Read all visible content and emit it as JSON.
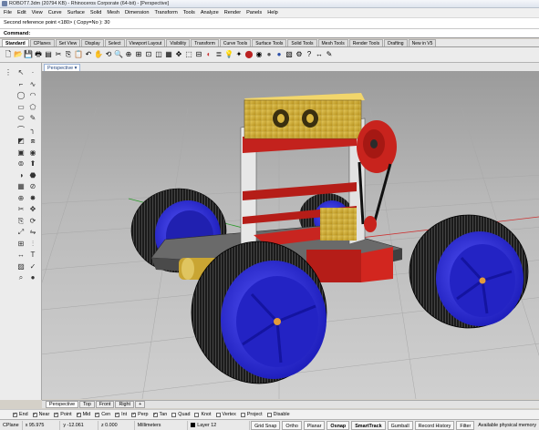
{
  "window": {
    "title": "ROBOT7.3dm (20794 KB) - Rhinoceros Corporate (64-bit) - [Perspective]"
  },
  "menu": [
    "File",
    "Edit",
    "View",
    "Curve",
    "Surface",
    "Solid",
    "Mesh",
    "Dimension",
    "Transform",
    "Tools",
    "Analyze",
    "Render",
    "Panels",
    "Help"
  ],
  "command_history": "Second reference point <180> ( Copy=No ): 30",
  "command_prompt": "Command:",
  "toolbar_tabs": [
    "Standard",
    "CPlanes",
    "Set View",
    "Display",
    "Select",
    "Viewport Layout",
    "Visibility",
    "Transform",
    "Curve Tools",
    "Surface Tools",
    "Solid Tools",
    "Mesh Tools",
    "Render Tools",
    "Drafting",
    "New in V5"
  ],
  "active_toolbar_tab": "Standard",
  "viewport": {
    "label": "Perspective",
    "menu_arrow": "▾"
  },
  "viewport_tabs": [
    "Perspective",
    "Top",
    "Front",
    "Right",
    "+"
  ],
  "osnaps": [
    {
      "label": "End",
      "checked": true
    },
    {
      "label": "Near",
      "checked": true
    },
    {
      "label": "Point",
      "checked": true
    },
    {
      "label": "Mid",
      "checked": true
    },
    {
      "label": "Cen",
      "checked": true
    },
    {
      "label": "Int",
      "checked": true
    },
    {
      "label": "Perp",
      "checked": true
    },
    {
      "label": "Tan",
      "checked": true
    },
    {
      "label": "Quad",
      "checked": false
    },
    {
      "label": "Knot",
      "checked": false
    },
    {
      "label": "Vertex",
      "checked": false
    },
    {
      "label": "Project",
      "checked": false
    },
    {
      "label": "Disable",
      "checked": false
    }
  ],
  "status": {
    "cplane": "CPlane",
    "x": "x 95.975",
    "y": "y -12.061",
    "z": "z 0.000",
    "units": "Millimeters",
    "layer": "Layer 12",
    "buttons": [
      "Grid Snap",
      "Ortho",
      "Planar",
      "Osnap",
      "SmartTrack",
      "Gumball",
      "Record History",
      "Filter"
    ],
    "bold_buttons": [
      "Osnap",
      "SmartTrack"
    ],
    "memory": "Available physical memory"
  },
  "colors": {
    "wheel_hub": "#2828d6",
    "tire": "#1a1a1a",
    "frame": "#c0201c",
    "battery_box": "#d8b43a",
    "chassis": "#5a5a5a"
  }
}
